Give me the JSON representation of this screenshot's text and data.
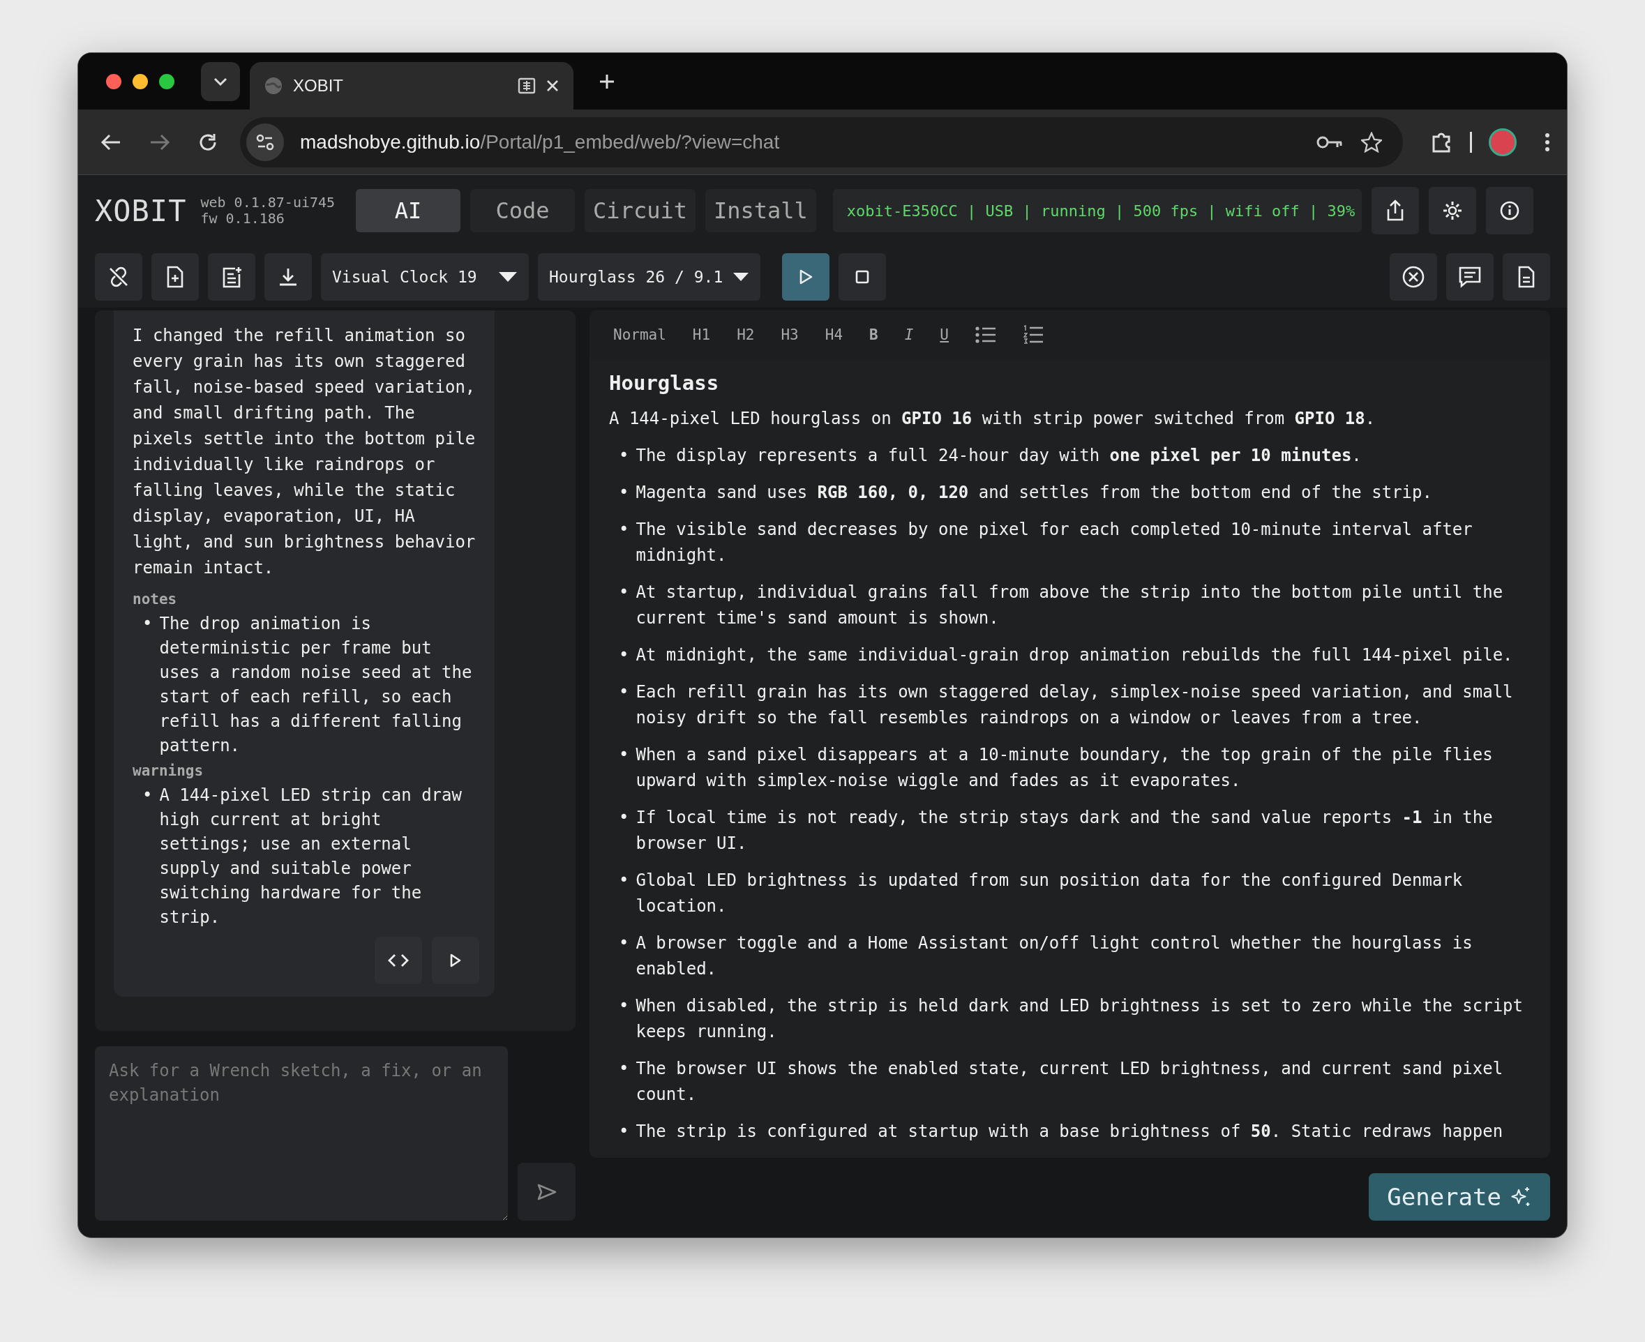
{
  "browser": {
    "tab_title": "XOBIT",
    "url_host": "madshobye.github.io",
    "url_path": "/Portal/p1_embed/web/?view=chat"
  },
  "app": {
    "logo": "XOBIT",
    "version_web": "web 0.1.87-ui745",
    "version_fw": "fw 0.1.186",
    "modes": [
      {
        "label": "AI",
        "selected": true
      },
      {
        "label": "Code",
        "selected": false
      },
      {
        "label": "Circuit",
        "selected": false
      },
      {
        "label": "Install",
        "selected": false
      }
    ],
    "status": "xobit-E350CC | USB | running | 500 fps | wifi off | 39%"
  },
  "toolbar": {
    "sketch_select": "Visual Clock 19",
    "file_info": "Hourglass 26 / 9.1"
  },
  "chat": {
    "message": "I changed the refill animation so every grain has its own staggered fall, noise-based speed variation, and small drifting path. The pixels settle into the bottom pile individually like raindrops or falling leaves, while the static display, evaporation, UI, HA light, and sun brightness behavior remain intact.",
    "sections": [
      {
        "heading": "notes",
        "items": [
          "The drop animation is deterministic per frame but uses a random noise seed at the start of each refill, so each refill has a different falling pattern."
        ]
      },
      {
        "heading": "warnings",
        "items": [
          "A 144-pixel LED strip can draw high current at bright settings; use an external supply and suitable power switching hardware for the strip."
        ]
      }
    ],
    "marker": "•",
    "input_placeholder": "Ask for a Wrench sketch, a fix, or an explanation"
  },
  "editor": {
    "format_buttons": [
      {
        "kind": "text",
        "label": "Normal"
      },
      {
        "kind": "text",
        "label": "H1"
      },
      {
        "kind": "text",
        "label": "H2"
      },
      {
        "kind": "text",
        "label": "H3"
      },
      {
        "kind": "text",
        "label": "H4"
      },
      {
        "kind": "bold",
        "label": "B"
      },
      {
        "kind": "italic",
        "label": "I"
      },
      {
        "kind": "underline",
        "label": "U"
      },
      {
        "kind": "bullet-list"
      },
      {
        "kind": "numbered-list"
      }
    ],
    "title": "Hourglass",
    "marker": "•",
    "intro": "A 144-pixel LED hourglass on **GPIO 16** with strip power switched from **GPIO 18**.",
    "bullets": [
      "The display represents a full 24-hour day with **one pixel per 10 minutes**.",
      "Magenta sand uses **RGB 160, 0, 120** and settles from the bottom end of the strip.",
      "The visible sand decreases by one pixel for each completed 10-minute interval after midnight.",
      "At startup, individual grains fall from above the strip into the bottom pile until the current time's sand amount is shown.",
      "At midnight, the same individual-grain drop animation rebuilds the full 144-pixel pile.",
      "Each refill grain has its own staggered delay, simplex-noise speed variation, and small noisy drift so the fall resembles raindrops on a window or leaves from a tree.",
      "When a sand pixel disappears at a 10-minute boundary, the top grain of the pile flies upward with simplex-noise wiggle and fades as it evaporates.",
      "If local time is not ready, the strip stays dark and the sand value reports **-1** in the browser UI.",
      "Global LED brightness is updated from sun position data for the configured Denmark location.",
      "A browser toggle and a Home Assistant on/off light control whether the hourglass is enabled.",
      "When disabled, the strip is held dark and LED brightness is set to zero while the script keeps running.",
      "The browser UI shows the enabled state, current LED brightness, and current sand pixel count.",
      "The strip is configured at startup with a base brightness of **50**. Static redraws happen"
    ],
    "generate": "Generate"
  }
}
